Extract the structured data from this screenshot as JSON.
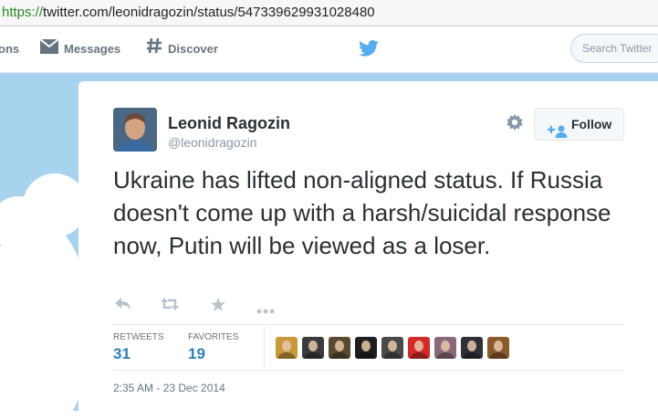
{
  "browser": {
    "url_scheme": "https://",
    "url_rest": "twitter.com/leonidragozin/status/547339629931028480"
  },
  "nav": {
    "notifications_label": "ons",
    "messages_label": "Messages",
    "discover_label": "Discover",
    "search_placeholder": "Search Twitter"
  },
  "tweet": {
    "full_name": "Leonid Ragozin",
    "username": "@leonidragozin",
    "follow_label": "Follow",
    "text": "Ukraine has lifted non-aligned status. If Russia doesn't come up with a harsh/suicidal response now, Putin will be viewed as a loser.",
    "retweets_label": "RETWEETS",
    "retweets_count": "31",
    "favorites_label": "FAVORITES",
    "favorites_count": "19",
    "timestamp": "2:35 AM - 23 Dec 2014"
  },
  "colors": {
    "sky": "#a8d3ee",
    "twitter_blue": "#55acee",
    "link_blue": "#2a7fb8",
    "url_green": "#2a8a2a"
  },
  "icons": {
    "messages": "envelope-icon",
    "discover": "hash-icon",
    "brand": "twitter-bird-icon",
    "settings": "gear-icon",
    "follow": "add-user-icon",
    "reply": "reply-icon",
    "retweet": "retweet-icon",
    "favorite": "star-icon",
    "more": "more-icon"
  },
  "favoriters": [
    {
      "name": "favoriter-avatar-1",
      "color": "#c89a3c"
    },
    {
      "name": "favoriter-avatar-2",
      "color": "#3b3b3b"
    },
    {
      "name": "favoriter-avatar-3",
      "color": "#5a4a32"
    },
    {
      "name": "favoriter-avatar-4",
      "color": "#1e1e1e"
    },
    {
      "name": "favoriter-avatar-5",
      "color": "#4a4a4a"
    },
    {
      "name": "favoriter-avatar-6",
      "color": "#d32a2a"
    },
    {
      "name": "favoriter-avatar-7",
      "color": "#8a6a7a"
    },
    {
      "name": "favoriter-avatar-8",
      "color": "#2f2f3a"
    },
    {
      "name": "favoriter-avatar-9",
      "color": "#8a5a2a"
    }
  ]
}
